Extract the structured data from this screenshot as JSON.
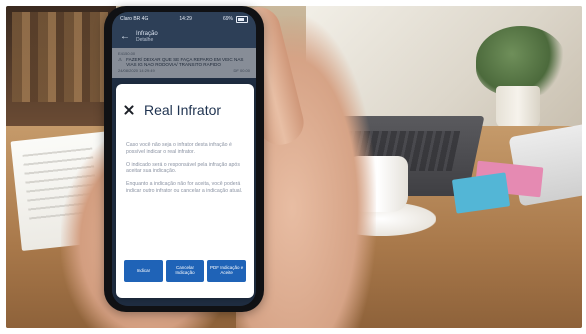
{
  "status": {
    "carrier": "Claro BR 4G",
    "time": "14:29",
    "battery": "69%"
  },
  "appbar": {
    "title": "Infração",
    "subtitle": "Detalhe"
  },
  "background_item": {
    "code": "E4150.00",
    "description": "FAZER/ DEIXAR QUE SE FAÇA REPARO EM VEIC NAS VIAS IG NAO RODOVIA/ TRANSITO RAPIDO",
    "date": "24/08/2020 14:29:49",
    "tag": "DF 00.00"
  },
  "modal": {
    "title": "Real Infrator",
    "paragraphs": [
      "Caso você não seja o infrator desta infração é possível indicar o real infrator.",
      "O indicado será o responsável pela infração após aceitar sua indicação.",
      "Enquanto a indicação não for aceita, você poderá indicar outro infrator ou cancelar a indicação atual."
    ],
    "buttons": {
      "indicate": "Indicar",
      "cancel": "Cancelar Indicação",
      "pdf": "PDF Indicação e Aceite"
    }
  },
  "colors": {
    "primary_button": "#1f63b7",
    "title": "#1f3350",
    "body_text": "#8b93a3",
    "app_header": "#2d3f57"
  }
}
